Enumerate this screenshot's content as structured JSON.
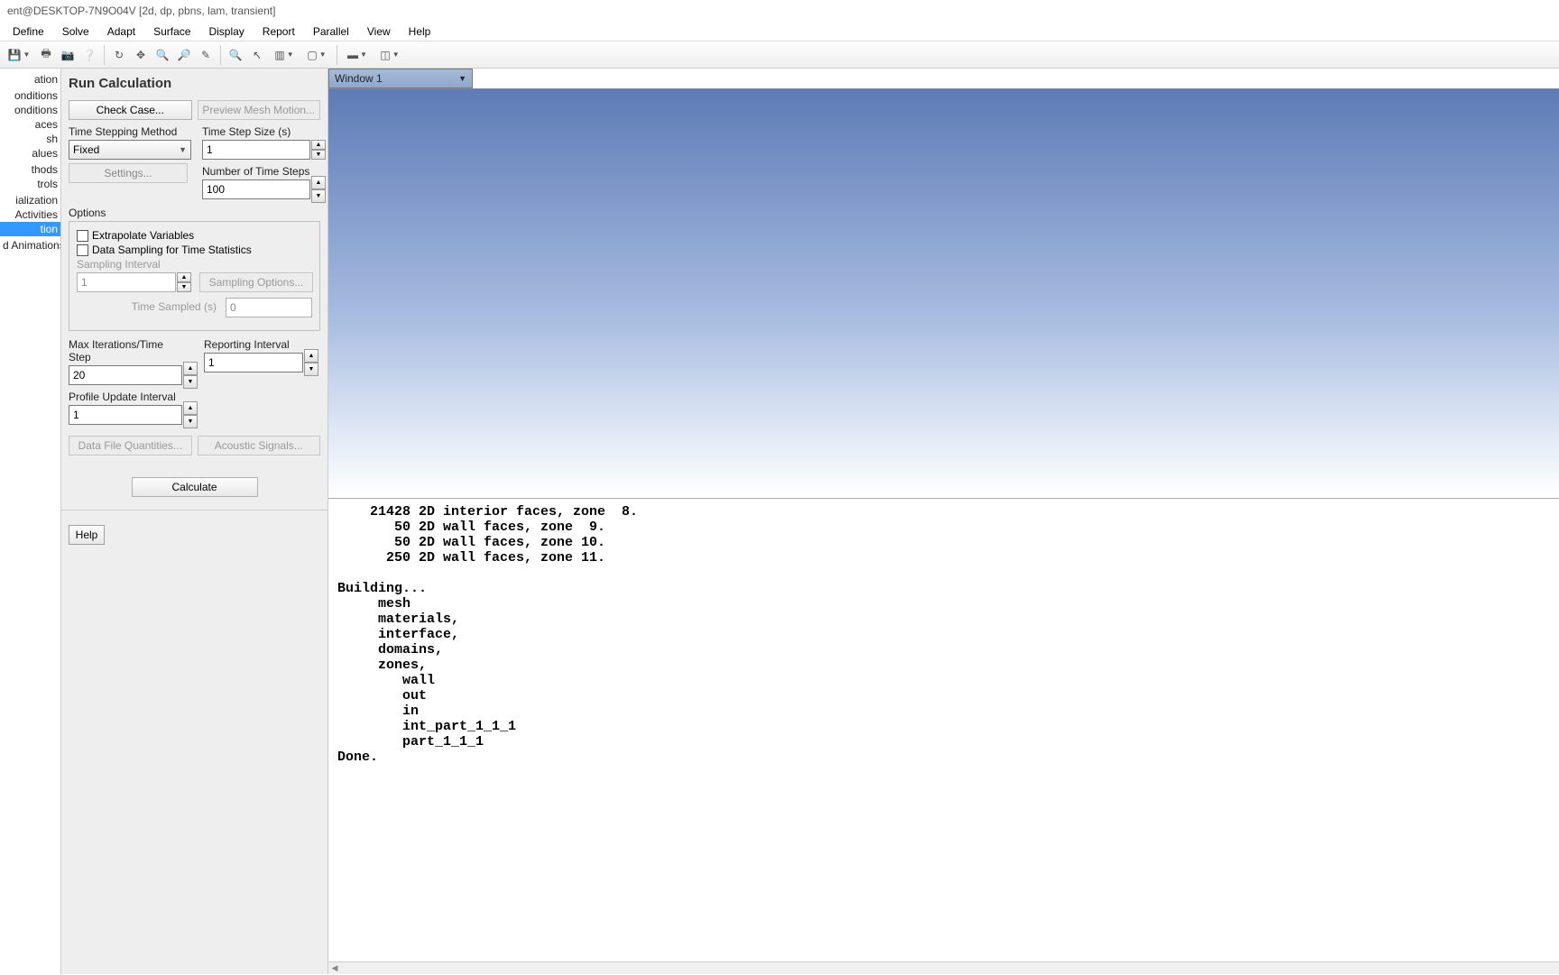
{
  "title_bar": "ent@DESKTOP-7N9O04V  [2d, dp, pbns, lam, transient]",
  "menu": {
    "items": [
      "Define",
      "Solve",
      "Adapt",
      "Surface",
      "Display",
      "Report",
      "Parallel",
      "View",
      "Help"
    ]
  },
  "tree": {
    "items": [
      "ation",
      "",
      "onditions",
      "onditions",
      "aces",
      "sh",
      "alues",
      "",
      "thods",
      "trols",
      "",
      "ialization",
      "Activities",
      "tion",
      "",
      "d Animations"
    ],
    "selected_index": 13
  },
  "panel": {
    "title": "Run Calculation",
    "check_case": "Check Case...",
    "preview_mesh": "Preview Mesh Motion...",
    "time_stepping_method_label": "Time Stepping Method",
    "time_stepping_method_value": "Fixed",
    "time_step_size_label": "Time Step Size (s)",
    "time_step_size_value": "1",
    "num_time_steps_label": "Number of Time Steps",
    "num_time_steps_value": "100",
    "settings_btn": "Settings...",
    "options_label": "Options",
    "extrapolate_label": "Extrapolate Variables",
    "data_sampling_label": "Data Sampling for Time Statistics",
    "sampling_interval_label": "Sampling Interval",
    "sampling_interval_value": "1",
    "sampling_options": "Sampling Options...",
    "time_sampled_label": "Time Sampled (s)",
    "time_sampled_value": "0",
    "max_iter_label": "Max Iterations/Time Step",
    "max_iter_value": "20",
    "reporting_interval_label": "Reporting Interval",
    "reporting_interval_value": "1",
    "profile_update_label": "Profile Update Interval",
    "profile_update_value": "1",
    "data_file_quant": "Data File Quantities...",
    "acoustic_signals": "Acoustic Signals...",
    "calculate": "Calculate",
    "help_btn": "Help"
  },
  "viewport": {
    "window_select": "Window 1",
    "console_text": "    21428 2D interior faces, zone  8.\n       50 2D wall faces, zone  9.\n       50 2D wall faces, zone 10.\n      250 2D wall faces, zone 11.\n\nBuilding...\n     mesh\n     materials,\n     interface,\n     domains,\n     zones,\n        wall\n        out\n        in\n        int_part_1_1_1\n        part_1_1_1\nDone."
  }
}
